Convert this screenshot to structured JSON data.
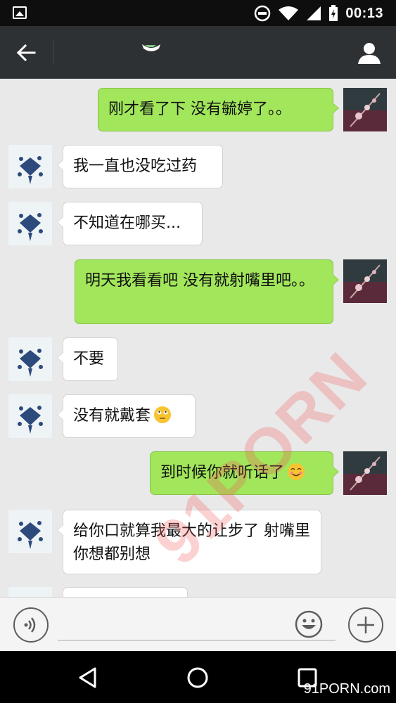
{
  "status_bar": {
    "time": "00:13"
  },
  "title_bar": {
    "title": ""
  },
  "messages": [
    {
      "side": "right",
      "text": "刚才看了下 没有毓婷了。。"
    },
    {
      "side": "left",
      "text": "我一直也没吃过药"
    },
    {
      "side": "left",
      "text": "不知道在哪买..."
    },
    {
      "side": "right",
      "text": "明天我看看吧 没有就射嘴里吧。。"
    },
    {
      "side": "left",
      "text": "不要"
    },
    {
      "side": "left",
      "text": "没有就戴套"
    },
    {
      "side": "right",
      "text": "到时候你就听话了"
    },
    {
      "side": "left",
      "text": "给你口就算我最大的让步了 射嘴里你想都别想"
    },
    {
      "side": "left",
      "text": ""
    }
  ],
  "icons": {
    "back": "arrow-left-icon",
    "profile": "person-icon",
    "voice": "voice-icon",
    "emoji": "smiley-icon",
    "plus": "plus-icon",
    "nav_back": "triangle-back-icon",
    "nav_home": "circle-home-icon",
    "nav_recents": "square-recents-icon"
  },
  "watermark": {
    "text": "91PORN",
    "brand": "91PORN.com"
  },
  "colors": {
    "chat_background": "#e9e9e9",
    "sent_bubble": "#a2e65b",
    "received_bubble": "#ffffff",
    "title_bar": "#2e3134"
  }
}
